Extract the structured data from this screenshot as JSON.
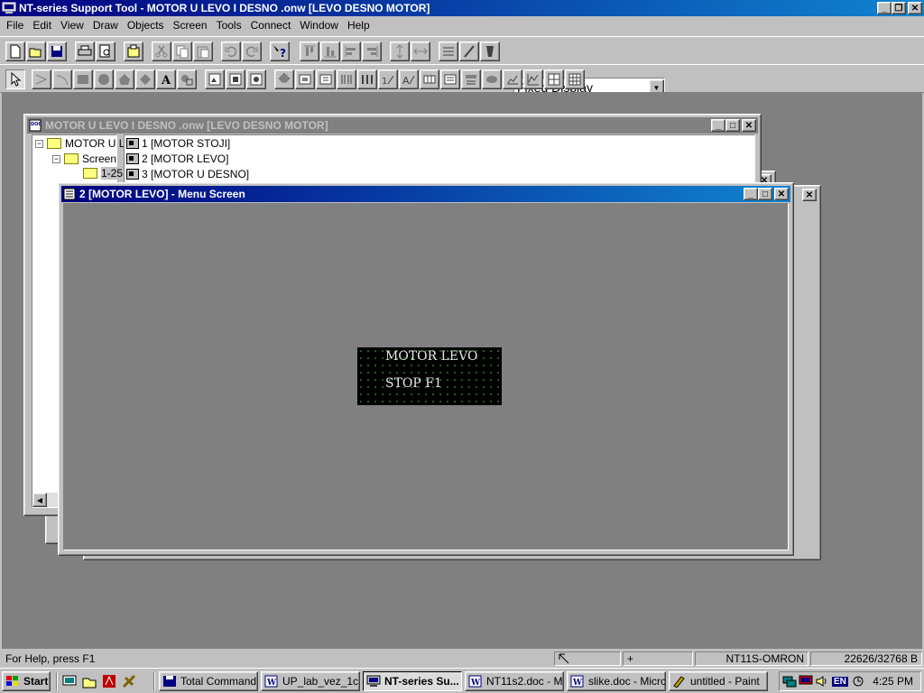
{
  "app": {
    "title": "NT-series Support Tool - MOTOR U LEVO I DESNO  .onw [LEVO DESNO MOTOR]"
  },
  "menu": [
    "File",
    "Edit",
    "View",
    "Draw",
    "Objects",
    "Screen",
    "Tools",
    "Connect",
    "Window",
    "Help"
  ],
  "toolbar": {
    "display_mode": "Fixed Display",
    "icons_row1": [
      "new-icon",
      "open-icon",
      "save-icon",
      "print-icon",
      "print-preview-icon",
      "screen-capture-icon",
      "cut-icon",
      "copy-icon",
      "paste-icon",
      "undo-icon",
      "redo-icon",
      "context-help-icon",
      "align-top-icon",
      "align-bottom-icon",
      "align-left-icon",
      "align-right-icon",
      "space-vertical-icon",
      "space-horizontal-icon",
      "list-icon",
      "pen-icon",
      "fill-icon"
    ],
    "icons_row2": [
      "select-arrow-icon",
      "polyline-icon",
      "arc-icon",
      "rectangle-icon",
      "circle-icon",
      "polygon-icon",
      "sector-icon",
      "text-icon",
      "mark-icon",
      "image-icon",
      "library-icon",
      "bitmap-icon",
      "lamp-icon",
      "touch-switch-icon",
      "numeral-display-icon",
      "string-display-icon",
      "bar-graph-icon",
      "numeral-input-icon",
      "string-input-icon",
      "thumbwheel-icon",
      "list-selector-icon",
      "alarm-list-icon",
      "alarm-history-icon",
      "analog-meter-icon",
      "broken-line-icon",
      "trend-graph-icon",
      "table-icon",
      "grid-icon"
    ]
  },
  "project_window": {
    "title": "MOTOR U LEVO I DESNO  .onw  [LEVO DESNO MOTOR]",
    "tree": {
      "root": "MOTOR U L",
      "child": "Screen",
      "leaf": "1-25"
    },
    "screens": [
      "1 [MOTOR STOJI]",
      "2 [MOTOR LEVO]",
      "3 [MOTOR U DESNO]"
    ]
  },
  "menu_screen_window": {
    "title": "2 [MOTOR LEVO] - Menu Screen",
    "lcd": {
      "line1": "MOTOR LEVO",
      "line2": "STOP  F1"
    }
  },
  "status": {
    "help": "For Help, press F1",
    "coord": "+",
    "model": "NT11S-OMRON",
    "memory": "22626/32768 B"
  },
  "taskbar": {
    "start": "Start",
    "tasks": [
      "Total Command...",
      "UP_lab_vez_1c...",
      "NT-series Su...",
      "NT11s2.doc - M...",
      "slike.doc - Micro...",
      "untitled - Paint"
    ],
    "language": "EN",
    "clock": "4:25 PM"
  },
  "colors": {
    "title_active": "#000080",
    "title_gradient_end": "#1084d0",
    "desktop": "#808080",
    "face": "#c0c0c0",
    "lcd_bg": "#000000",
    "lcd_dot": "#2f7a2f"
  }
}
